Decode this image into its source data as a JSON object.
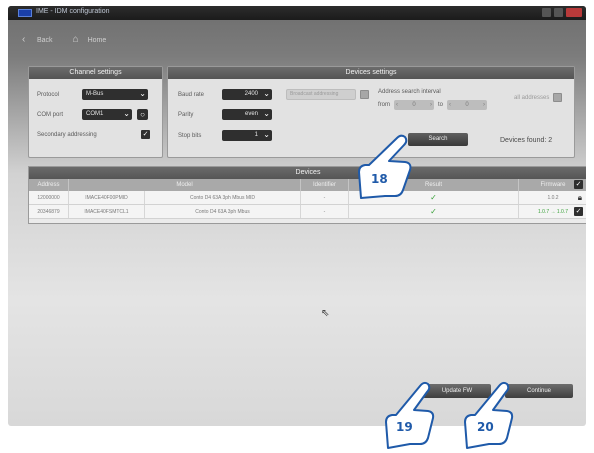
{
  "window": {
    "title": "IME - IDM configuration"
  },
  "nav": {
    "back_label": "Back",
    "home_label": "Home"
  },
  "channel_settings": {
    "title": "Channel settings",
    "protocol_label": "Protocol",
    "protocol_value": "M-Bus",
    "com_port_label": "COM port",
    "com_port_value": "COM1",
    "secondary_label": "Secondary addressing",
    "secondary_checked": true
  },
  "devices_settings": {
    "title": "Devices settings",
    "baud_label": "Baud rate",
    "baud_value": "2400",
    "parity_label": "Parity",
    "parity_value": "even",
    "stop_label": "Stop bits",
    "stop_value": "1",
    "broadcast_label": "Broadcast addressing",
    "interval_label": "Address search interval",
    "from_label": "from",
    "to_label": "to",
    "from_value": "0",
    "to_value": "0",
    "all_label": "all addresses",
    "search_label": "Search",
    "found_label": "Devices found: 2"
  },
  "devices": {
    "title": "Devices",
    "columns": [
      "Address",
      "Model",
      "Identifier",
      "Result",
      "Firmware"
    ],
    "rows": [
      {
        "address": "12000000",
        "code": "IMACE40F00PMID",
        "model": "Conto D4 63A 3ph Mbus MID",
        "identifier": "-",
        "result": "✓",
        "firmware": "1.0.2"
      },
      {
        "address": "20346879",
        "code": "IMACE40FSMTCL1",
        "model": "Conto D4 63A 3ph Mbus",
        "identifier": "-",
        "result": "✓",
        "firmware": "1.0.7 → 1.0.7"
      }
    ]
  },
  "buttons": {
    "update_fw": "Update FW",
    "continue": "Continue"
  },
  "callouts": [
    "18",
    "19",
    "20"
  ]
}
